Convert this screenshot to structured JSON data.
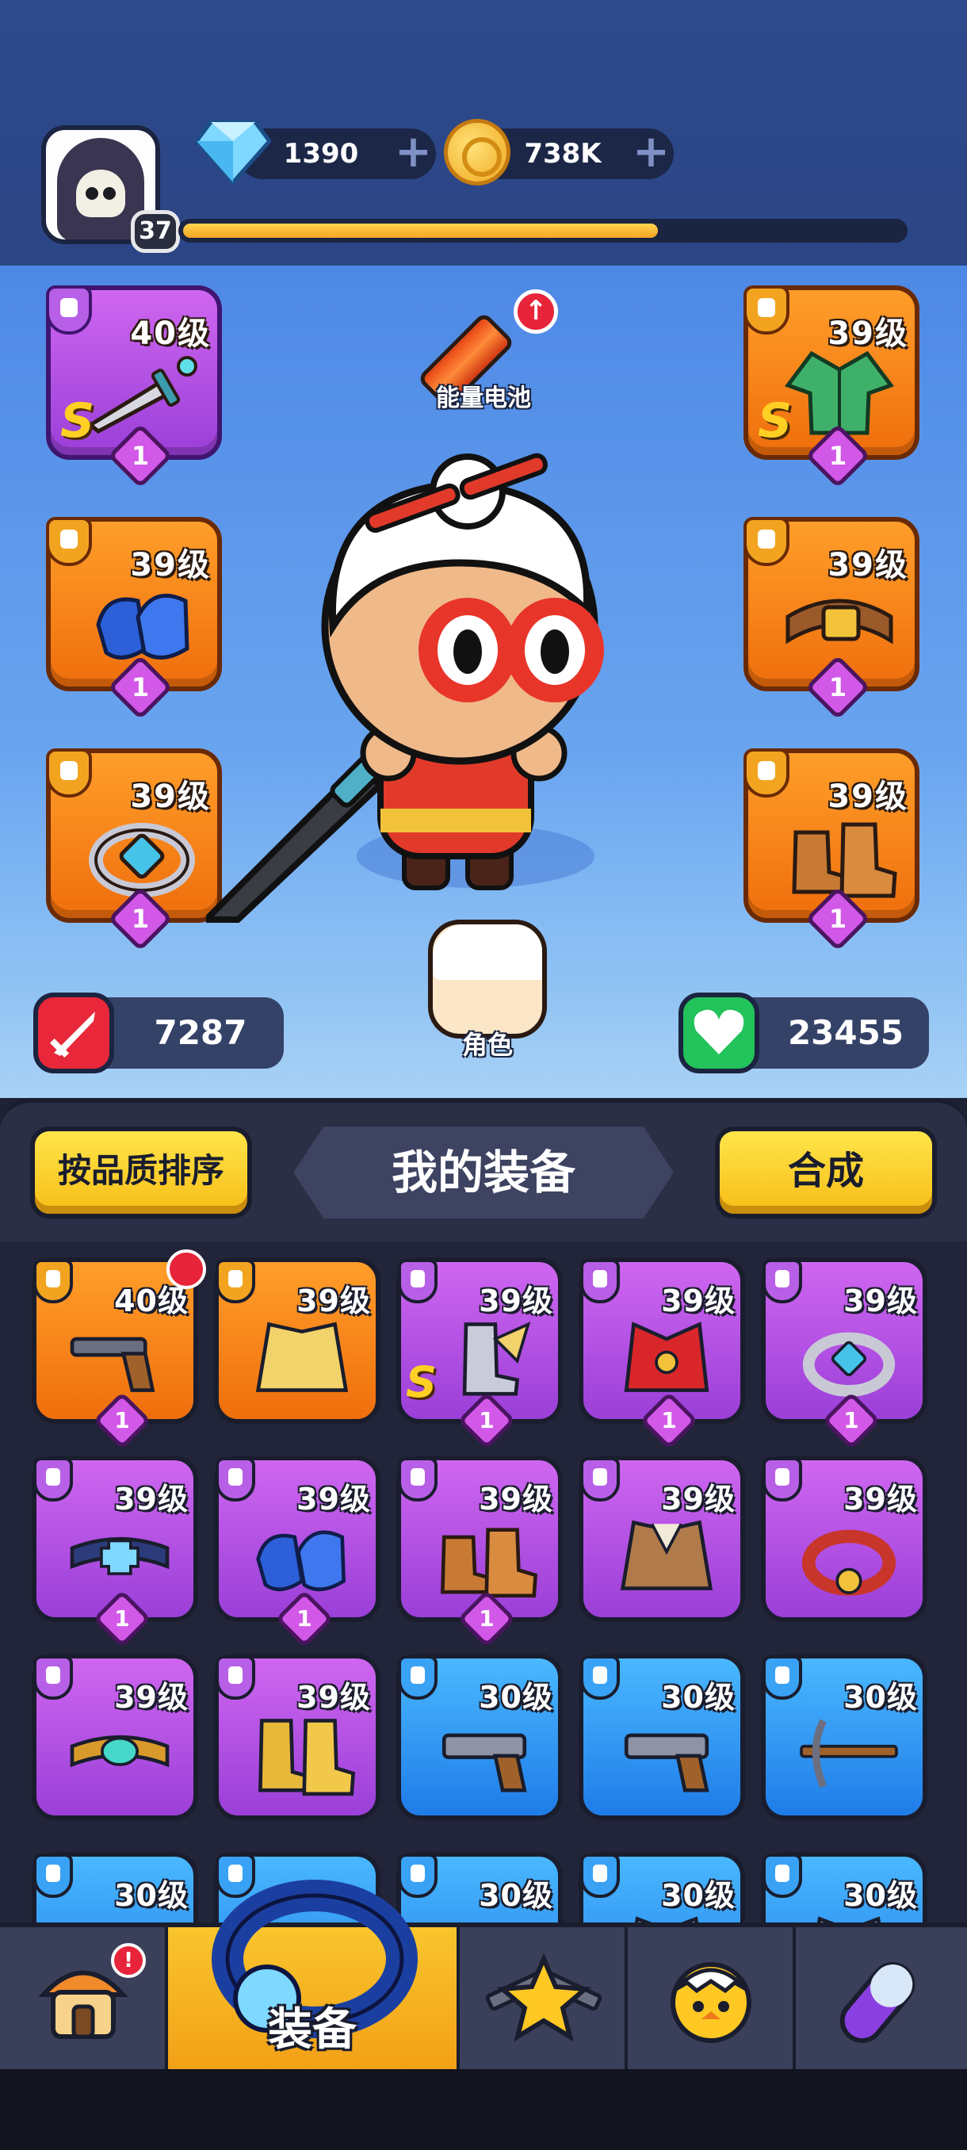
{
  "player": {
    "level": "37",
    "xp_progress": 0.66
  },
  "currencies": {
    "gems": "1390",
    "coins": "738K"
  },
  "energy_battery": {
    "label": "能量电池"
  },
  "equipped": {
    "weapon": {
      "level": "40级",
      "rarity": "S",
      "count": "1"
    },
    "armor": {
      "level": "39级",
      "rarity": "S",
      "count": "1"
    },
    "gloves": {
      "level": "39级",
      "count": "1"
    },
    "belt": {
      "level": "39级",
      "count": "1"
    },
    "ring": {
      "level": "39级",
      "count": "1"
    },
    "boots": {
      "level": "39级",
      "count": "1"
    }
  },
  "role": {
    "label": "角色"
  },
  "stats": {
    "attack": "7287",
    "health": "23455"
  },
  "inventory": {
    "sort_label": "按品质排序",
    "title": "我的装备",
    "merge_label": "合成",
    "items": [
      {
        "level": "40级",
        "color": "orange",
        "item": "revolver",
        "count": "1",
        "new": true
      },
      {
        "level": "39级",
        "color": "orange",
        "item": "golden-coat",
        "count": ""
      },
      {
        "level": "39级",
        "color": "purple",
        "item": "winged-boot",
        "count": "1",
        "rarity": "S"
      },
      {
        "level": "39级",
        "color": "purple",
        "item": "red-vest",
        "count": "1"
      },
      {
        "level": "39级",
        "color": "purple",
        "item": "ring",
        "count": "1"
      },
      {
        "level": "39级",
        "color": "purple",
        "item": "cross-belt",
        "count": "1"
      },
      {
        "level": "39级",
        "color": "purple",
        "item": "gloves",
        "count": "1"
      },
      {
        "level": "39级",
        "color": "purple",
        "item": "boots",
        "count": "1"
      },
      {
        "level": "39级",
        "color": "purple",
        "item": "jacket",
        "count": ""
      },
      {
        "level": "39级",
        "color": "purple",
        "item": "red-ring",
        "count": ""
      },
      {
        "level": "39级",
        "color": "purple",
        "item": "gem-belt",
        "count": ""
      },
      {
        "level": "39级",
        "color": "purple",
        "item": "gold-boots",
        "count": ""
      },
      {
        "level": "30级",
        "color": "blue",
        "item": "pistol",
        "count": ""
      },
      {
        "level": "30级",
        "color": "blue",
        "item": "pistol",
        "count": ""
      },
      {
        "level": "30级",
        "color": "blue",
        "item": "crossbow",
        "count": ""
      },
      {
        "level": "30级",
        "color": "blue",
        "item": "pistol",
        "count": ""
      },
      {
        "level": "",
        "color": "blue",
        "item": "pistol",
        "count": ""
      },
      {
        "level": "30级",
        "color": "blue",
        "item": "pistol",
        "count": ""
      },
      {
        "level": "30级",
        "color": "blue",
        "item": "armor",
        "count": ""
      },
      {
        "level": "30级",
        "color": "blue",
        "item": "armor",
        "count": ""
      }
    ]
  },
  "nav": {
    "tabs": [
      {
        "name": "shop",
        "label": "",
        "icon": "house-icon",
        "alert": "!"
      },
      {
        "name": "equipment",
        "label": "装备",
        "icon": "ring-icon",
        "active": true
      },
      {
        "name": "battle",
        "label": "",
        "icon": "star-guns-icon"
      },
      {
        "name": "pets",
        "label": "",
        "icon": "chick-icon"
      },
      {
        "name": "skills",
        "label": "",
        "icon": "capsule-icon"
      }
    ]
  },
  "colors": {
    "orange": "#f28a1c",
    "purple": "#b454e6",
    "blue": "#2e94f2",
    "accent_yellow": "#f9c52d"
  }
}
